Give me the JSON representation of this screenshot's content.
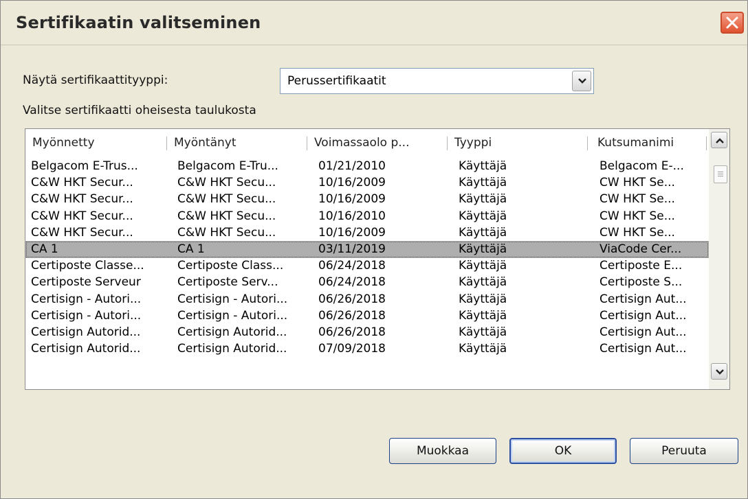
{
  "window": {
    "title": "Sertifikaatin valitseminen"
  },
  "filter": {
    "label": "Näytä sertifikaattityyppi:",
    "selected": "Perussertifikaatit"
  },
  "instruction": "Valitse sertifikaatti oheisesta taulukosta",
  "table": {
    "columns": [
      "Myönnetty",
      "Myöntänyt",
      "Voimassaolo p...",
      "Tyyppi",
      "Kutsumanimi"
    ],
    "rows": [
      [
        "Belgacom E-Trus...",
        "Belgacom E-Tru...",
        "01/21/2010",
        "Käyttäjä",
        "Belgacom E-..."
      ],
      [
        "C&W HKT Secur...",
        "C&W HKT Secu...",
        "10/16/2009",
        "Käyttäjä",
        "CW HKT Se..."
      ],
      [
        "C&W HKT Secur...",
        "C&W HKT Secu...",
        "10/16/2009",
        "Käyttäjä",
        "CW HKT Se..."
      ],
      [
        "C&W HKT Secur...",
        "C&W HKT Secu...",
        "10/16/2010",
        "Käyttäjä",
        "CW HKT Se..."
      ],
      [
        "C&W HKT Secur...",
        "C&W HKT Secu...",
        "10/16/2009",
        "Käyttäjä",
        "CW HKT Se..."
      ],
      [
        "CA 1",
        "CA 1",
        "03/11/2019",
        "Käyttäjä",
        "ViaCode Cer..."
      ],
      [
        "Certiposte Classe...",
        "Certiposte Class...",
        "06/24/2018",
        "Käyttäjä",
        "Certiposte E..."
      ],
      [
        "Certiposte Serveur",
        "Certiposte Serv...",
        "06/24/2018",
        "Käyttäjä",
        "Certiposte S..."
      ],
      [
        "Certisign - Autori...",
        "Certisign - Autori...",
        "06/26/2018",
        "Käyttäjä",
        "Certisign Aut..."
      ],
      [
        "Certisign - Autori...",
        "Certisign - Autori...",
        "06/26/2018",
        "Käyttäjä",
        "Certisign Aut..."
      ],
      [
        "Certisign Autorid...",
        "Certisign Autorid...",
        "06/26/2018",
        "Käyttäjä",
        "Certisign Aut..."
      ],
      [
        "Certisign Autorid...",
        "Certisign Autorid...",
        "07/09/2018",
        "Käyttäjä",
        "Certisign Aut..."
      ]
    ],
    "selected_index": 5
  },
  "buttons": {
    "edit": "Muokkaa",
    "ok": "OK",
    "cancel": "Peruuta"
  },
  "colors": {
    "selection": "#aeaeae",
    "close_button": "#e0532f",
    "dialog_background": "#ece9d8"
  }
}
